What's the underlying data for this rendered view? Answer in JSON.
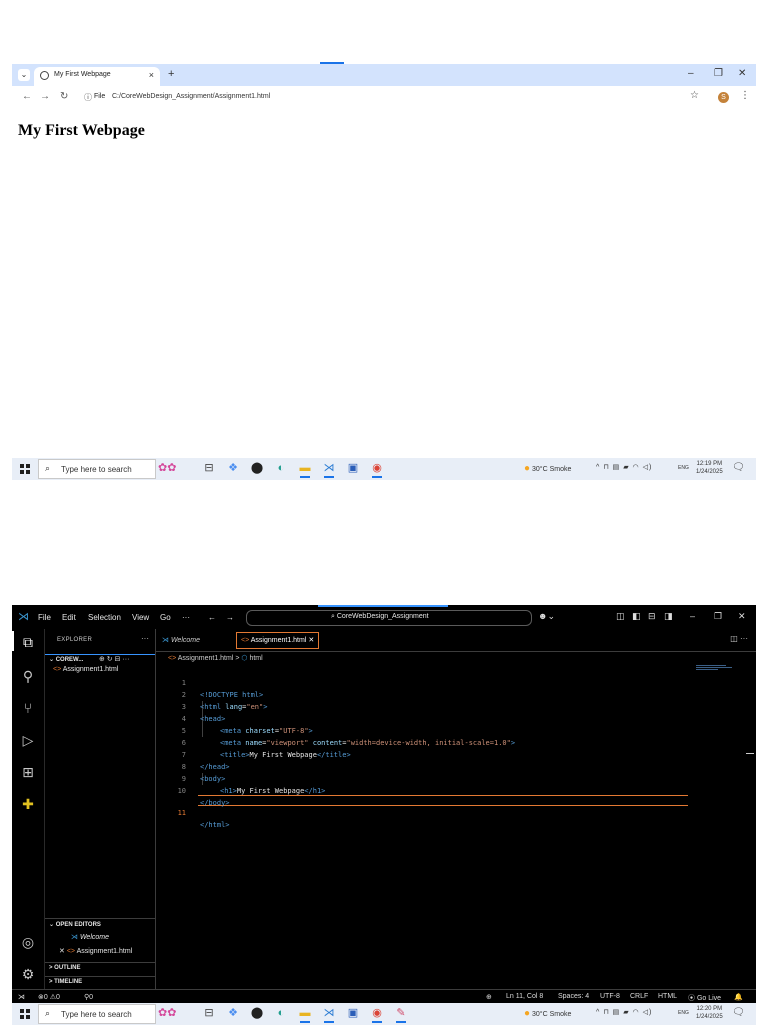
{
  "browser": {
    "tab_title": "My First Webpage",
    "tab_close": "×",
    "new_tab": "+",
    "omnibox_icon": "ⓘ",
    "omnibox_scheme": "File",
    "url": "C:/CoreWebDesign_Assignment/Assignment1.html",
    "profile_initial": "S",
    "page_heading": "My First Webpage",
    "icons": [
      "tab-menu-icon",
      "back-icon",
      "forward-icon",
      "reload-icon",
      "info-icon",
      "star-icon",
      "kebab-icon"
    ]
  },
  "taskbar_top": {
    "search_placeholder": "Type here to search",
    "weather": "30°C  Smoke",
    "lang": "ENG",
    "time": "12:19 PM",
    "date": "1/24/2025"
  },
  "vscode": {
    "menu": [
      "File",
      "Edit",
      "Selection",
      "View",
      "Go",
      "···"
    ],
    "command_center": "CoreWebDesign_Assignment",
    "explorer_title": "EXPLORER",
    "folder_label": "COREW...",
    "file_name": "Assignment1.html",
    "open_editors_label": "OPEN EDITORS",
    "open_editor_welcome": "Welcome",
    "open_editor_file": "Assignment1.html",
    "outline_label": "OUTLINE",
    "timeline_label": "TIMELINE",
    "tab_welcome": "Welcome",
    "tab_file": "Assignment1.html",
    "breadcrumb_file": "Assignment1.html",
    "breadcrumb_sep": ">",
    "breadcrumb_node": "html",
    "line_numbers": [
      "1",
      "2",
      "3",
      "4",
      "5",
      "6",
      "7",
      "8",
      "9",
      "10",
      "11"
    ],
    "code": {
      "l1_doctype": "<!DOCTYPE",
      "l1_html": " html>",
      "l2_open": "<html ",
      "l2_attr": "lang",
      "l2_eq": "=",
      "l2_val": "\"en\"",
      "l2_close": ">",
      "l3": "<head>",
      "l4_open": "<meta ",
      "l4_attr": "charset",
      "l4_eq": "=",
      "l4_val": "\"UTF-8\"",
      "l4_close": ">",
      "l5_open": "<meta ",
      "l5_attr1": "name",
      "l5_eq1": "=",
      "l5_val1": "\"viewport\"",
      "l5_sp": " ",
      "l5_attr2": "content",
      "l5_eq2": "=",
      "l5_val2": "\"width=device-width, initial-scale=1.0\"",
      "l5_close": ">",
      "l6_open": "<title>",
      "l6_text": "My First Webpage",
      "l6_close": "</title>",
      "l7": "</head>",
      "l8": "<body>",
      "l9_open": "<h1>",
      "l9_text": "My First Webpage",
      "l9_close": "</h1>",
      "l10": "</body>",
      "l11": "</html>"
    },
    "status": {
      "errors": "0",
      "warnings": "0",
      "ports": "0",
      "position": "Ln 11, Col 8",
      "spaces": "Spaces: 4",
      "encoding": "UTF-8",
      "eol": "CRLF",
      "language": "HTML",
      "go_live": "Go Live"
    }
  },
  "taskbar_bottom": {
    "search_placeholder": "Type here to search",
    "weather": "30°C  Smoke",
    "lang": "ENG",
    "time": "12:20 PM",
    "date": "1/24/2025"
  },
  "colors": {
    "browser_tabbar": "#d3e3fd",
    "vscode_bg": "#000000",
    "vscode_accent": "#e37933",
    "keyword_blue": "#569cd6",
    "string_orange": "#ce9178"
  }
}
